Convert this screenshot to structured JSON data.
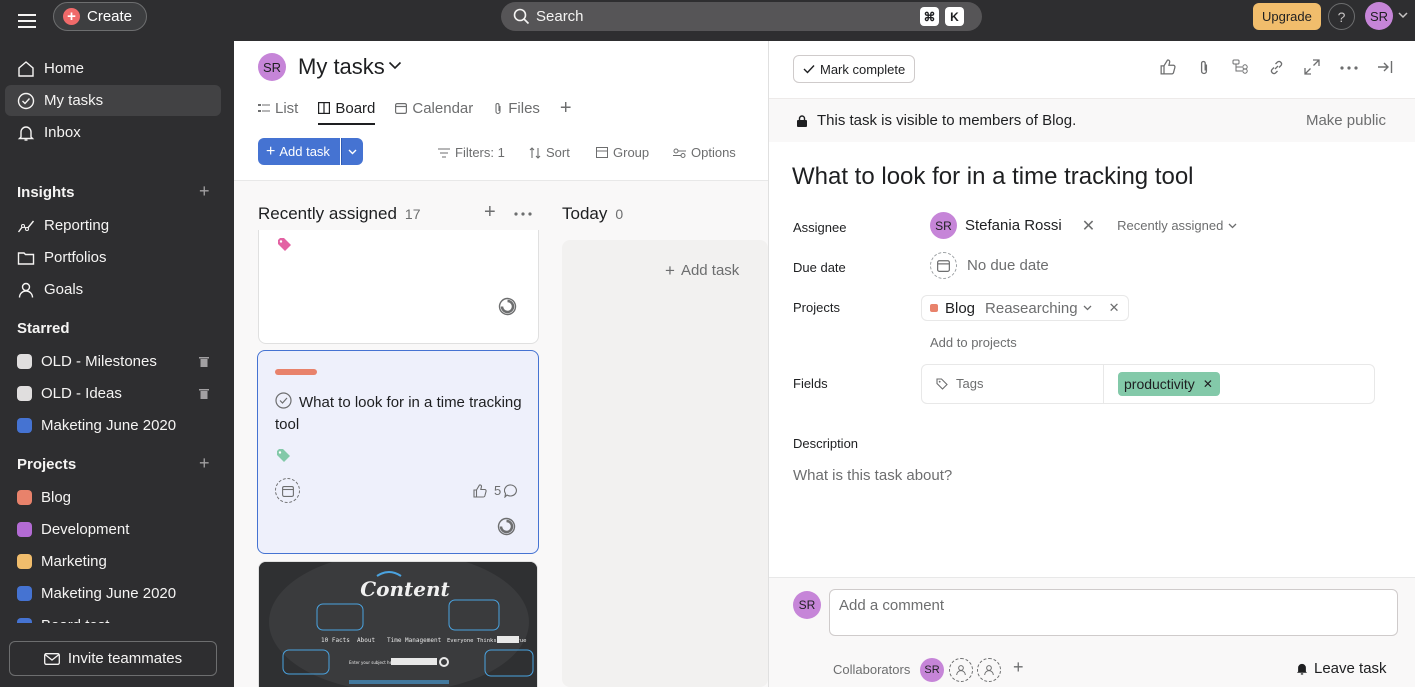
{
  "topbar": {
    "create_label": "Create",
    "search_label": "Search",
    "kbd_cmd": "⌘",
    "kbd_k": "K",
    "upgrade_label": "Upgrade",
    "help_label": "?",
    "user_initials": "SR"
  },
  "sidebar": {
    "nav": [
      {
        "label": "Home",
        "icon": "home-icon"
      },
      {
        "label": "My tasks",
        "icon": "check-circle-icon",
        "active": true
      },
      {
        "label": "Inbox",
        "icon": "bell-icon"
      }
    ],
    "insights_title": "Insights",
    "insights": [
      {
        "label": "Reporting",
        "icon": "chart-line-icon"
      },
      {
        "label": "Portfolios",
        "icon": "folder-icon"
      },
      {
        "label": "Goals",
        "icon": "person-icon"
      }
    ],
    "starred_title": "Starred",
    "starred": [
      {
        "label": "OLD - Milestones",
        "color": "#e0dede"
      },
      {
        "label": "OLD - Ideas",
        "color": "#e0dede"
      },
      {
        "label": "Maketing June 2020",
        "color": "#4573d2"
      }
    ],
    "projects_title": "Projects",
    "projects": [
      {
        "label": "Blog",
        "color": "#e8826b"
      },
      {
        "label": "Development",
        "color": "#b36bd4"
      },
      {
        "label": "Marketing",
        "color": "#f1bd6c"
      },
      {
        "label": "Maketing June 2020",
        "color": "#4573d2"
      },
      {
        "label": "Board test",
        "color": "#4573d2"
      }
    ],
    "invite_label": "Invite teammates"
  },
  "main": {
    "user_initials": "SR",
    "title": "My tasks",
    "tabs": [
      {
        "label": "List"
      },
      {
        "label": "Board",
        "active": true
      },
      {
        "label": "Calendar"
      },
      {
        "label": "Files"
      }
    ],
    "add_task_label": "Add task",
    "filters_label": "Filters: 1",
    "sort_label": "Sort",
    "group_label": "Group",
    "options_label": "Options",
    "columns": [
      {
        "title": "Recently assigned",
        "count": "17"
      },
      {
        "title": "Today",
        "count": "0"
      }
    ],
    "card": {
      "title": "What to look for in a time tracking tool",
      "likes": "5",
      "bar_color": "#e8826b",
      "tag_color": "#83c9a9"
    },
    "today_add_label": "Add task",
    "image_card": {
      "title_art": "Content",
      "items": [
        "10 Facts",
        "About",
        "Time Management",
        "Everyone Thinks Are True"
      ],
      "input_label": "Enter your subject here"
    }
  },
  "detail": {
    "mark_complete_label": "Mark complete",
    "visibility_text": "This task is visible to members of Blog.",
    "make_public_label": "Make public",
    "title": "What to look for in a time tracking tool",
    "assignee_label": "Assignee",
    "assignee_name": "Stefania Rossi",
    "assignee_initials": "SR",
    "assignee_section": "Recently assigned",
    "due_label": "Due date",
    "due_value": "No due date",
    "projects_label": "Projects",
    "project_name": "Blog",
    "project_section": "Reasearching",
    "project_color": "#e8826b",
    "add_projects_label": "Add to projects",
    "fields_label": "Fields",
    "tags_field_label": "Tags",
    "tag_value": "productivity",
    "tag_color": "#83c9a9",
    "description_label": "Description",
    "description_placeholder": "What is this task about?",
    "comment_placeholder": "Add a comment",
    "commenter_initials": "SR",
    "collaborators_label": "Collaborators",
    "collaborator_initials": "SR",
    "leave_task_label": "Leave task"
  }
}
